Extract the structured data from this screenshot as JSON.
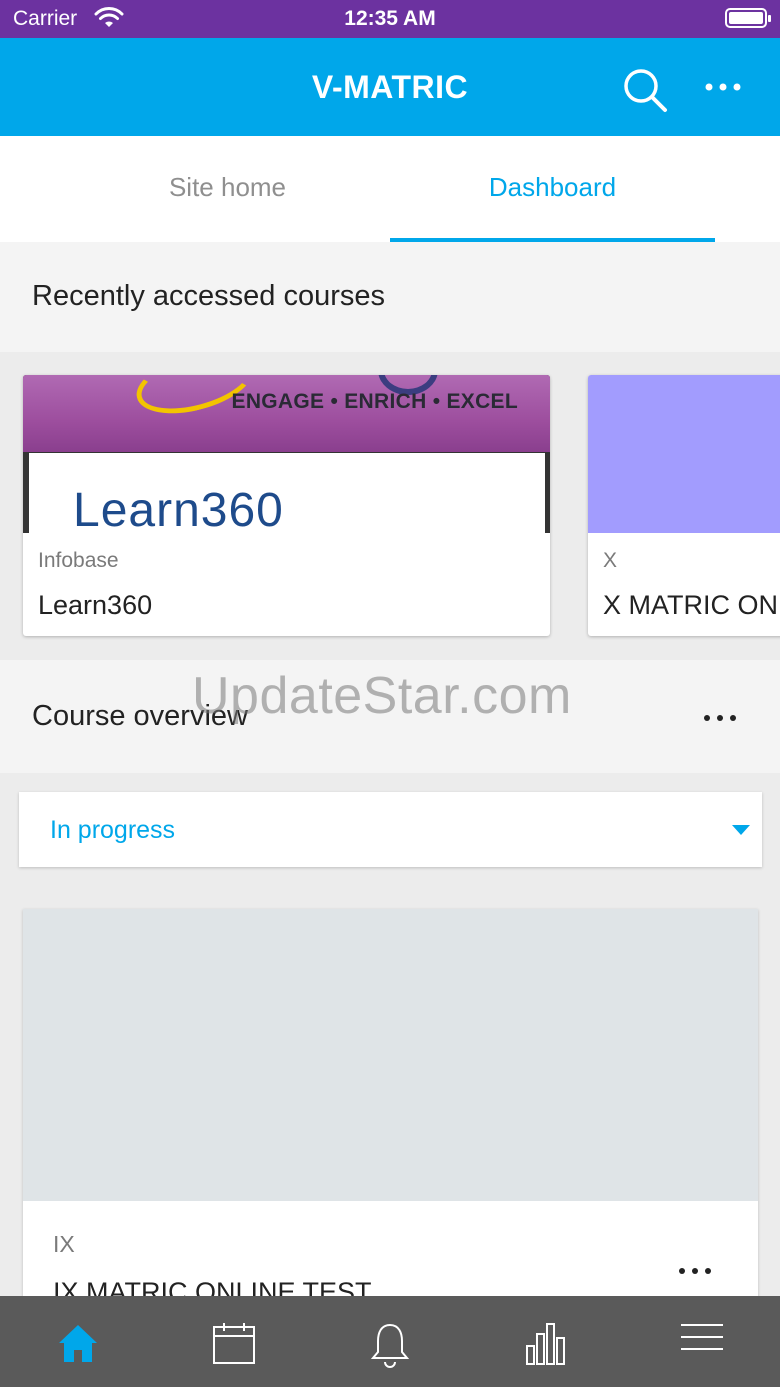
{
  "status_bar": {
    "carrier": "Carrier",
    "time": "12:35 AM"
  },
  "app_bar": {
    "title": "V-MATRIC",
    "search_icon": "search-icon",
    "more_icon": "more-horizontal-icon"
  },
  "tabs": [
    {
      "label": "Site home",
      "active": false
    },
    {
      "label": "Dashboard",
      "active": true
    }
  ],
  "recent": {
    "heading": "Recently accessed courses",
    "courses": [
      {
        "category": "Infobase",
        "name": "Learn360",
        "image_tagline": "ENGAGE • ENRICH • EXCEL",
        "image_logo_text": "Learn360"
      },
      {
        "category": "X",
        "name": "X MATRIC ONLINE TEST",
        "image_color": "#a29cfe"
      }
    ]
  },
  "overview": {
    "heading": "Course overview",
    "filter_value": "In progress",
    "course": {
      "category": "IX",
      "name": "IX MATRIC ONLINE TEST",
      "image_color": "#dfe4e7"
    }
  },
  "watermark": "UpdateStar.com",
  "bottom_nav": [
    {
      "icon": "home-icon",
      "active": true
    },
    {
      "icon": "calendar-icon",
      "active": false
    },
    {
      "icon": "bell-icon",
      "active": false
    },
    {
      "icon": "bar-chart-icon",
      "active": false
    },
    {
      "icon": "menu-icon",
      "active": false
    }
  ],
  "colors": {
    "status_bar": "#6c32a0",
    "accent": "#00a7ea",
    "bottom_nav": "#5a5a5a"
  }
}
